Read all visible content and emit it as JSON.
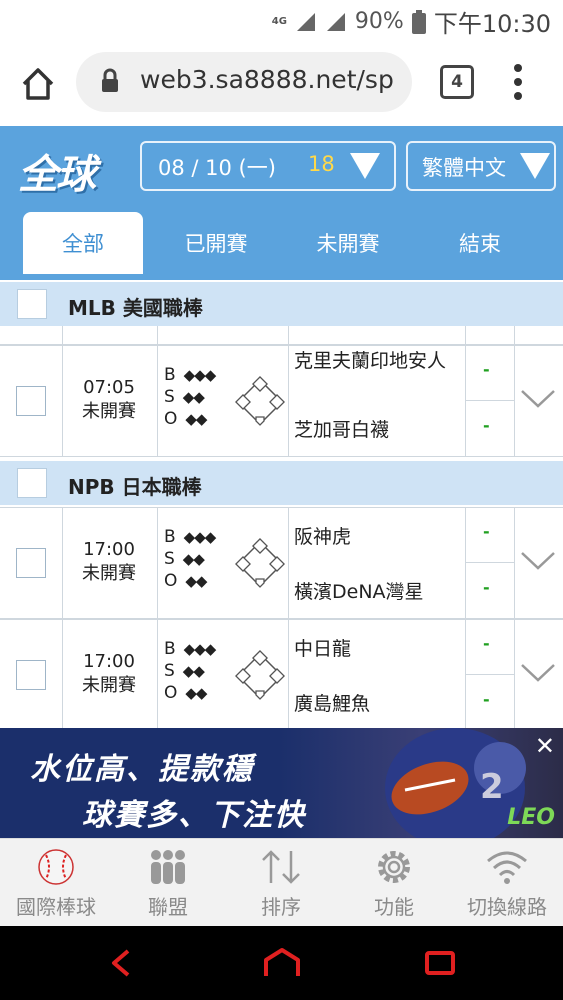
{
  "status_bar": {
    "network": "4G",
    "battery": "90%",
    "time": "下午10:30"
  },
  "browser": {
    "url": "web3.sa8888.net/sp",
    "tab_count": "4"
  },
  "header": {
    "logo": "全球",
    "date": "08 / 10 (一)",
    "count": "18",
    "language": "繁體中文"
  },
  "tabs": [
    {
      "label": "全部",
      "active": true
    },
    {
      "label": "已開賽",
      "active": false
    },
    {
      "label": "未開賽",
      "active": false
    },
    {
      "label": "結束",
      "active": false
    }
  ],
  "leagues": [
    {
      "name": "MLB 美國職棒",
      "matches": [
        {
          "time": "07:05",
          "status": "未開賽",
          "home": "克里夫蘭印地安人",
          "away": "芝加哥白襪",
          "odds_home": "-",
          "odds_away": "-"
        }
      ]
    },
    {
      "name": "NPB 日本職棒",
      "matches": [
        {
          "time": "17:00",
          "status": "未開賽",
          "home": "阪神虎",
          "away": "橫濱DeNA灣星",
          "odds_home": "-",
          "odds_away": "-"
        },
        {
          "time": "17:00",
          "status": "未開賽",
          "home": "中日龍",
          "away": "廣島鯉魚",
          "odds_home": "-",
          "odds_away": "-"
        }
      ]
    }
  ],
  "bso_labels": {
    "b": "B",
    "s": "S",
    "o": "O"
  },
  "ad": {
    "line1": "水位高、提款穩",
    "line2": "球賽多、下注快",
    "close": "✕",
    "brand": "LEO"
  },
  "bottom_nav": [
    {
      "label": "國際棒球",
      "icon": "baseball-icon"
    },
    {
      "label": "聯盟",
      "icon": "league-icon"
    },
    {
      "label": "排序",
      "icon": "sort-icon"
    },
    {
      "label": "功能",
      "icon": "gear-icon"
    },
    {
      "label": "切換線路",
      "icon": "wifi-icon"
    }
  ],
  "colors": {
    "header_blue": "#5ba3dd",
    "league_bar": "#cfe3f5",
    "count_yellow": "#ffd94a",
    "nav_red": "#e02020"
  }
}
